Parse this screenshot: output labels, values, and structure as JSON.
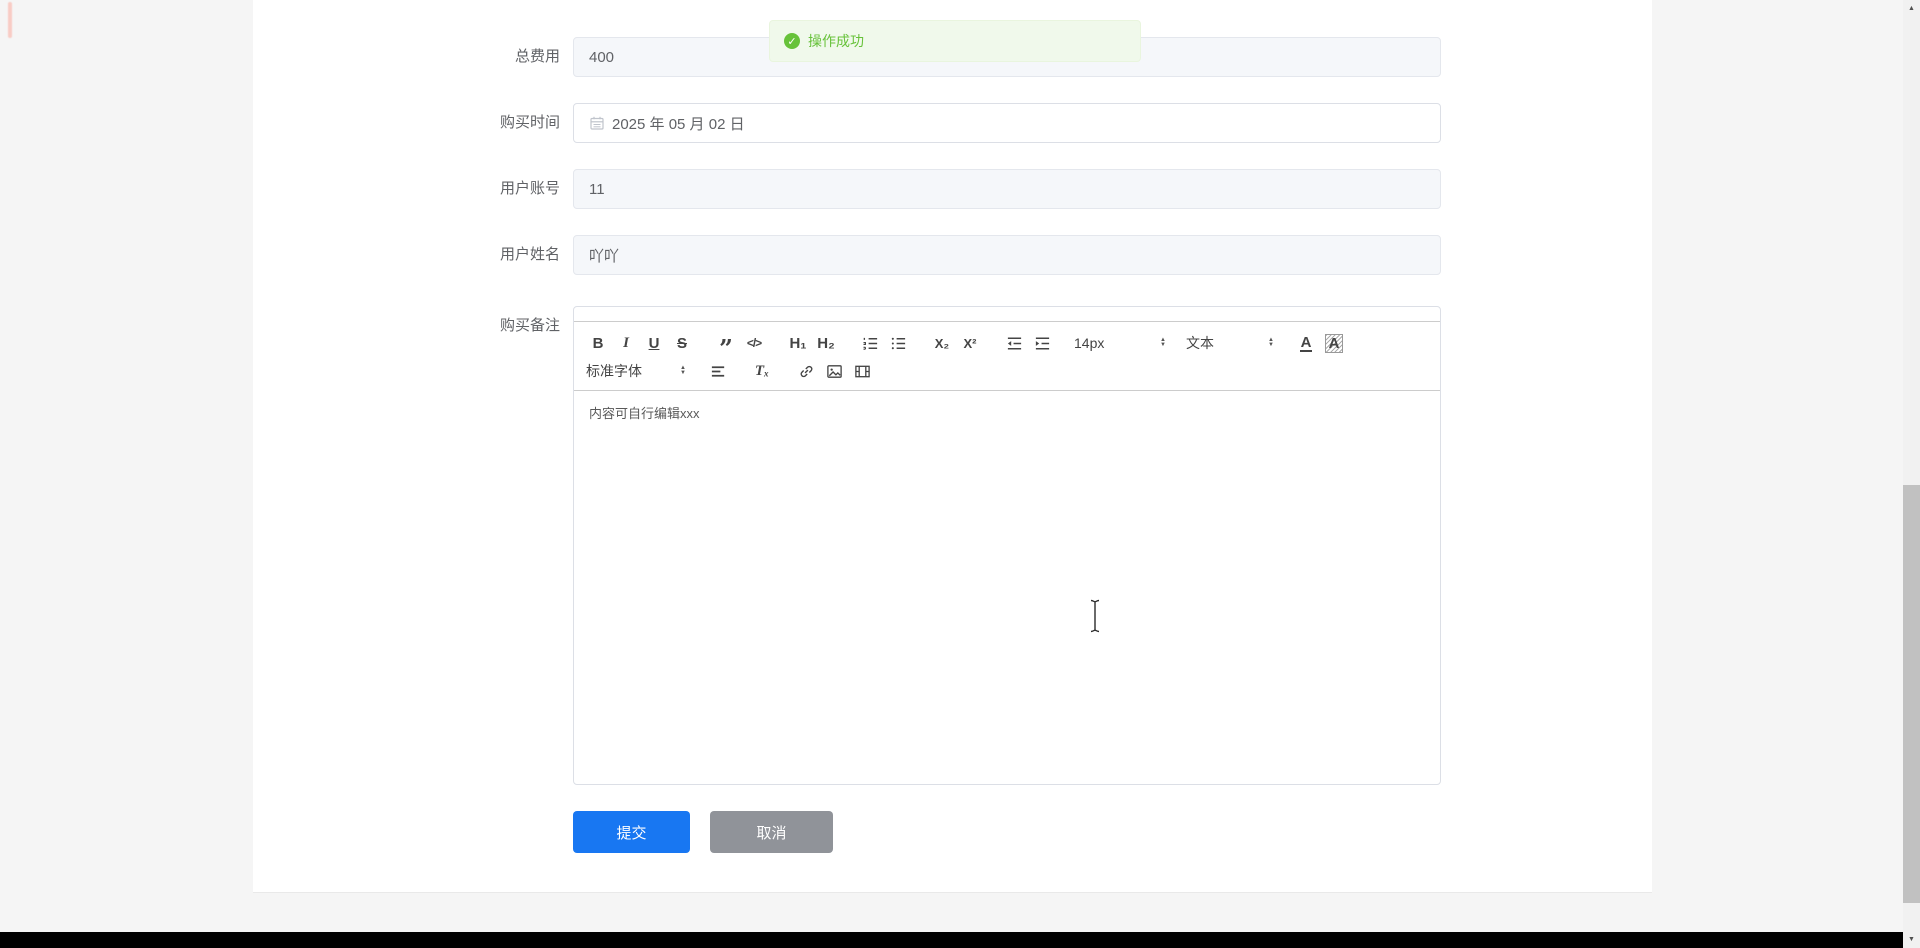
{
  "toast": {
    "text": "操作成功"
  },
  "form": {
    "items": [
      {
        "label": "总费用",
        "value": "400"
      },
      {
        "label": "购买时间",
        "value": "2025 年 05 月 02 日"
      },
      {
        "label": "用户账号",
        "value": "11"
      },
      {
        "label": "用户姓名",
        "value": "吖吖"
      },
      {
        "label": "购买备注",
        "value": ""
      }
    ]
  },
  "editor": {
    "toolbar": {
      "bold": "B",
      "italic": "I",
      "underline": "U",
      "strike": "S",
      "blockquote": "”",
      "code": "</>",
      "header1": "H₁",
      "header2": "H₂",
      "subscript": "X₂",
      "superscript": "X²",
      "size": "14px",
      "format": "文本",
      "color": "A",
      "background": "A",
      "font": "标准字体",
      "clean": "Tₓ"
    },
    "content": "内容可自行编辑xxx"
  },
  "actions": {
    "submit": "提交",
    "cancel": "取消"
  },
  "colors": {
    "primary": "#1877f2",
    "cancel_gray": "#909399",
    "success": "#67c23a",
    "toast_bg": "#f0f9eb",
    "page_bg": "#f5f5f5",
    "taskbar": "#000000",
    "disabled_input_bg": "#f5f7fa",
    "input_border": "#dcdfe6"
  }
}
